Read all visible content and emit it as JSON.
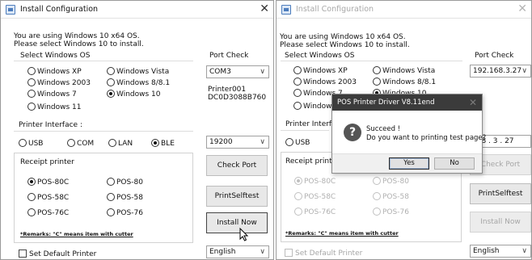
{
  "left_window": {
    "title": "Install Configuration",
    "close_glyph": "✕",
    "info_line1": "You are using Windows 10 x64 OS.",
    "info_line2": "Please select Windows 10 to install.",
    "select_os_title": "Select Windows OS",
    "os_options": [
      "Windows XP",
      "Windows Vista",
      "Windows 2003",
      "Windows 8/8.1",
      "Windows 7",
      "Windows 10",
      "Windows 11"
    ],
    "os_selected": "Windows 10",
    "port_check_title": "Port Check",
    "port_value": "COM3",
    "printer_name": "Printer001",
    "printer_id": "DC0D3088B760",
    "interface_title": "Printer Interface :",
    "interface_options": [
      "USB",
      "COM",
      "LAN",
      "BLE"
    ],
    "interface_selected": "BLE",
    "baud_value": "19200",
    "check_port_label": "Check Port",
    "receipt_title": "Receipt printer",
    "receipt_options": [
      "POS-80C",
      "POS-80",
      "POS-58C",
      "POS-58",
      "POS-76C",
      "POS-76"
    ],
    "receipt_selected": "POS-80C",
    "print_selftest_label": "PrintSelftest",
    "install_now_label": "Install Now",
    "remarks": "*Remarks: \"C\" means item with cutter",
    "set_default_label": "Set Default Printer",
    "language_value": "English"
  },
  "right_window": {
    "title": "Install Configuration",
    "close_glyph": "✕",
    "info_line1": "You are using Windows 10 x64 OS.",
    "info_line2": "Please select Windows 10 to install.",
    "select_os_title": "Select Windows OS",
    "os_visible": [
      "Windows XP",
      "Windows Vista",
      "Windows 2003",
      "Windows 8/8.1",
      "Windows 7",
      "Windows 10",
      "Window"
    ],
    "port_check_title": "Port Check",
    "ip_value": "192.168.3.27",
    "interface_title_partial": "Printer Interfa",
    "usb_label": "USB",
    "ip_partial": "168 . 3 . 27",
    "receipt_title_partial": "Receipt printer",
    "receipt_options": [
      "POS-80C",
      "POS-80",
      "POS-58C",
      "POS-58",
      "POS-76C",
      "POS-76"
    ],
    "check_port_label": "Check Port",
    "print_selftest_label": "PrintSelftest",
    "install_now_label": "Install Now",
    "remarks": "*Remarks: \"C\" means item with cutter",
    "set_default_label": "Set Default Printer",
    "language_value": "English"
  },
  "dialog": {
    "title": "POS Printer Driver V8.11end",
    "close_glyph": "✕",
    "icon": "question-icon",
    "line1": "Succeed !",
    "line2": "Do you want to printing test page?",
    "yes_label": "Yes",
    "no_label": "No"
  },
  "icons": {
    "app": "app-icon",
    "caret": "chevron-down-icon",
    "cursor": "mouse-cursor-icon"
  },
  "colors": {
    "dialog_title_bg": "#3b3b3b",
    "disabled_text": "#a6a6a6",
    "button_face": "#e8e8e8"
  }
}
